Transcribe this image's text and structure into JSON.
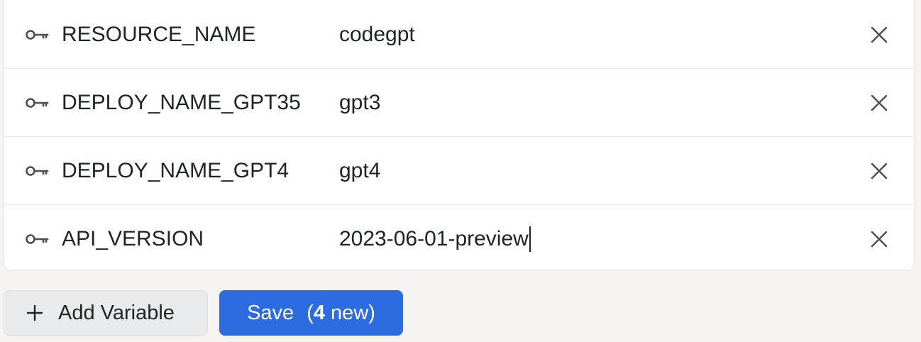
{
  "variables": [
    {
      "name": "RESOURCE_NAME",
      "value": "codegpt"
    },
    {
      "name": "DEPLOY_NAME_GPT35",
      "value": "gpt3"
    },
    {
      "name": "DEPLOY_NAME_GPT4",
      "value": "gpt4"
    },
    {
      "name": "API_VERSION",
      "value": "2023-06-01-preview"
    }
  ],
  "icons": {
    "variable": "key-icon",
    "remove": "close-icon",
    "add": "plus-icon"
  },
  "actions": {
    "add_label": "Add Variable",
    "save_label": "Save",
    "save_paren_open": "(",
    "save_count": "4",
    "save_suffix": " new)"
  },
  "colors": {
    "primary": "#2c6ce0",
    "text": "#1f2328",
    "icon": "#4a4f55",
    "background": "#f5f4f2"
  }
}
